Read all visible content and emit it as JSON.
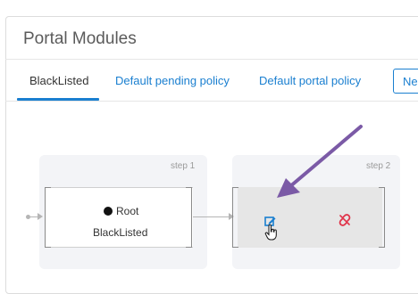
{
  "header": {
    "title": "Portal Modules"
  },
  "tabs": [
    {
      "label": "BlackListed",
      "active": true
    },
    {
      "label": "Default pending policy",
      "active": false
    },
    {
      "label": "Default portal policy",
      "active": false
    }
  ],
  "new_button_label": "Ne",
  "steps": [
    {
      "label": "step 1"
    },
    {
      "label": "step 2"
    }
  ],
  "root_node": {
    "line1": "Root",
    "line2": "BlackListed"
  },
  "step2_node": {
    "edit_icon": "edit-icon",
    "unlink_icon": "unlink-icon"
  },
  "colors": {
    "accent": "#1a7fd0",
    "annotation_arrow": "#7b5aa6",
    "unlink": "#e0344a"
  }
}
